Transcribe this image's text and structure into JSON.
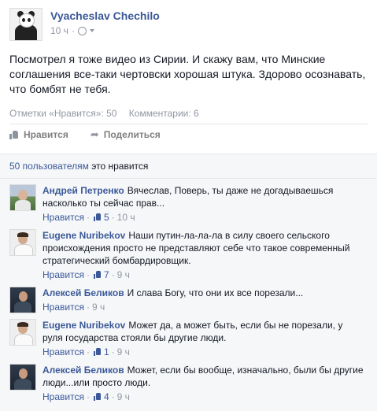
{
  "post": {
    "author": "Vyacheslav Chechilo",
    "time": "10 ч",
    "text": "Посмотрел я тоже видео из Сирии. И скажу вам, что Минские соглашения все-таки чертовски хорошая штука. Здорово осознавать, что бомбят не тебя.",
    "likes_stat": "Отметки «Нравится»: 50",
    "comments_stat": "Комментарии: 6"
  },
  "actions": {
    "like": "Нравится",
    "share": "Поделиться"
  },
  "likes_bar": {
    "link": "50 пользователям",
    "suffix": "это нравится"
  },
  "comments": [
    {
      "author": "Андрей Петренко",
      "text": "Вячеслав, Поверь, ты даже не догадываешься насколько ты сейчас прав...",
      "like": "Нравится",
      "sep": "·",
      "count": "5",
      "time": "10 ч"
    },
    {
      "author": "Eugene Nuribekov",
      "text": "Наши путин-ла-ла-ла в силу своего сельского происхождения просто не представляют себе что такое современный стратегический бомбардировщик.",
      "like": "Нравится",
      "sep": "·",
      "count": "7",
      "time": "9 ч"
    },
    {
      "author": "Алексей Беликов",
      "text": "И слава Богу, что они их все порезали...",
      "like": "Нравится",
      "sep": "·",
      "count": "",
      "time": "9 ч"
    },
    {
      "author": "Eugene Nuribekov",
      "text": "Может да, а может быть, если бы не порезали, у руля государства стояли бы другие люди.",
      "like": "Нравится",
      "sep": "·",
      "count": "1",
      "time": "9 ч"
    },
    {
      "author": "Алексей Беликов",
      "text": "Может, если бы вообще, изначально, были бы другие люди...или просто люди.",
      "like": "Нравится",
      "sep": "·",
      "count": "4",
      "time": "9 ч"
    }
  ],
  "icons": {
    "globe": "globe-icon",
    "like": "thumbs-up-icon",
    "share": "share-arrow-icon"
  },
  "colors": {
    "link": "#3b5998",
    "meta": "#9197a3",
    "comment_bg": "#f6f7f9"
  }
}
